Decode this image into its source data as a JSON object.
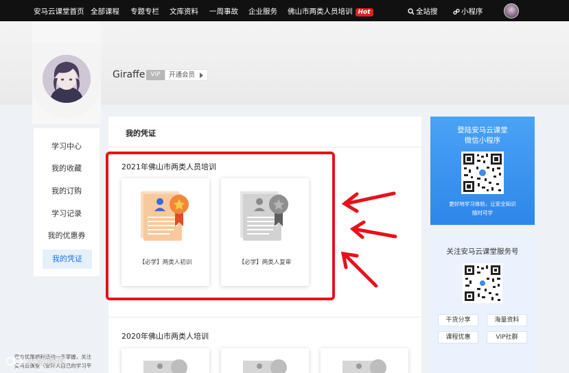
{
  "nav": {
    "items": [
      "安马云课堂首页",
      "全部课程",
      "专题专栏",
      "文库资料",
      "一周事故",
      "企业服务",
      "佛山市两类人员培训"
    ],
    "hot_badge": "Hot",
    "search_label": "全站搜",
    "miniprogram_label": "小程序"
  },
  "profile": {
    "username": "Giraffe",
    "vip_badge": "VIP",
    "open_vip_label": "开通会员"
  },
  "sidebar": {
    "items": [
      {
        "label": "学习中心"
      },
      {
        "label": "我的收藏"
      },
      {
        "label": "我的订购"
      },
      {
        "label": "学习记录"
      },
      {
        "label": "我的优惠券"
      },
      {
        "label": "我的凭证",
        "active": true
      }
    ]
  },
  "main": {
    "title": "我的凭证",
    "sections": [
      {
        "title": "2021年佛山市两类人员培训",
        "certificates": [
          {
            "label": "【必学】两类人初训",
            "status": "colored"
          },
          {
            "label": "【必学】两类人复审",
            "status": "gray"
          }
        ]
      },
      {
        "title": "2020年佛山市两类人培训"
      }
    ]
  },
  "right": {
    "miniprogram_card": {
      "title_line1": "登陆安马云课堂",
      "title_line2": "微信小程序",
      "desc_line1": "更好地学习体验，让安全知识",
      "desc_line2": "随时可学"
    },
    "service_card": {
      "title": "关注安马云课堂服务号",
      "tags": [
        "干货分享",
        "海量资料",
        "课程优惠",
        "VIP社群"
      ],
      "desc_line1": "官方优惠福利活动一手掌握，关注",
      "desc_line2": "安马云课堂（安环人自己的学习平"
    }
  },
  "watermark": "大数跨境",
  "colors": {
    "nav_bg": "#111111",
    "accent_blue": "#1a73d9",
    "hot_red": "#e02020",
    "annotation_red": "#e8101a",
    "cert_orange": "#f0873a"
  }
}
